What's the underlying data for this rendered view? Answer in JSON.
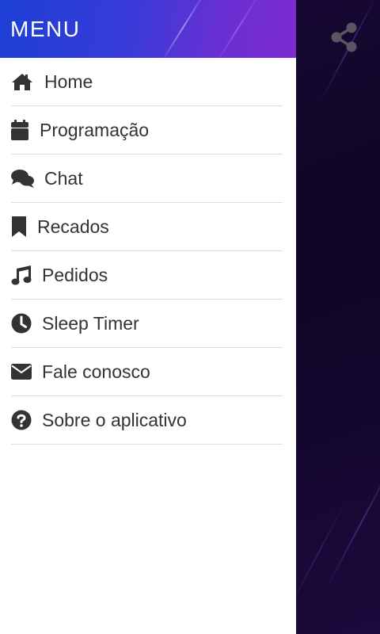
{
  "drawer": {
    "title": "MENU",
    "header_gradient": [
      "#1c3fd6",
      "#7d2bd0"
    ],
    "items": [
      {
        "label": "Home",
        "icon": "home-icon"
      },
      {
        "label": "Programação",
        "icon": "calendar-icon"
      },
      {
        "label": "Chat",
        "icon": "chat-bubbles-icon"
      },
      {
        "label": "Recados",
        "icon": "bookmark-icon"
      },
      {
        "label": "Pedidos",
        "icon": "music-note-icon"
      },
      {
        "label": "Sleep Timer",
        "icon": "clock-icon"
      },
      {
        "label": "Fale conosco",
        "icon": "envelope-icon"
      },
      {
        "label": "Sobre o aplicativo",
        "icon": "question-circle-icon"
      }
    ]
  },
  "toolbar": {
    "share_icon": "share-icon"
  },
  "colors": {
    "text": "#333333",
    "divider": "#dddddd",
    "icon": "#333333",
    "background": "#14072e"
  }
}
